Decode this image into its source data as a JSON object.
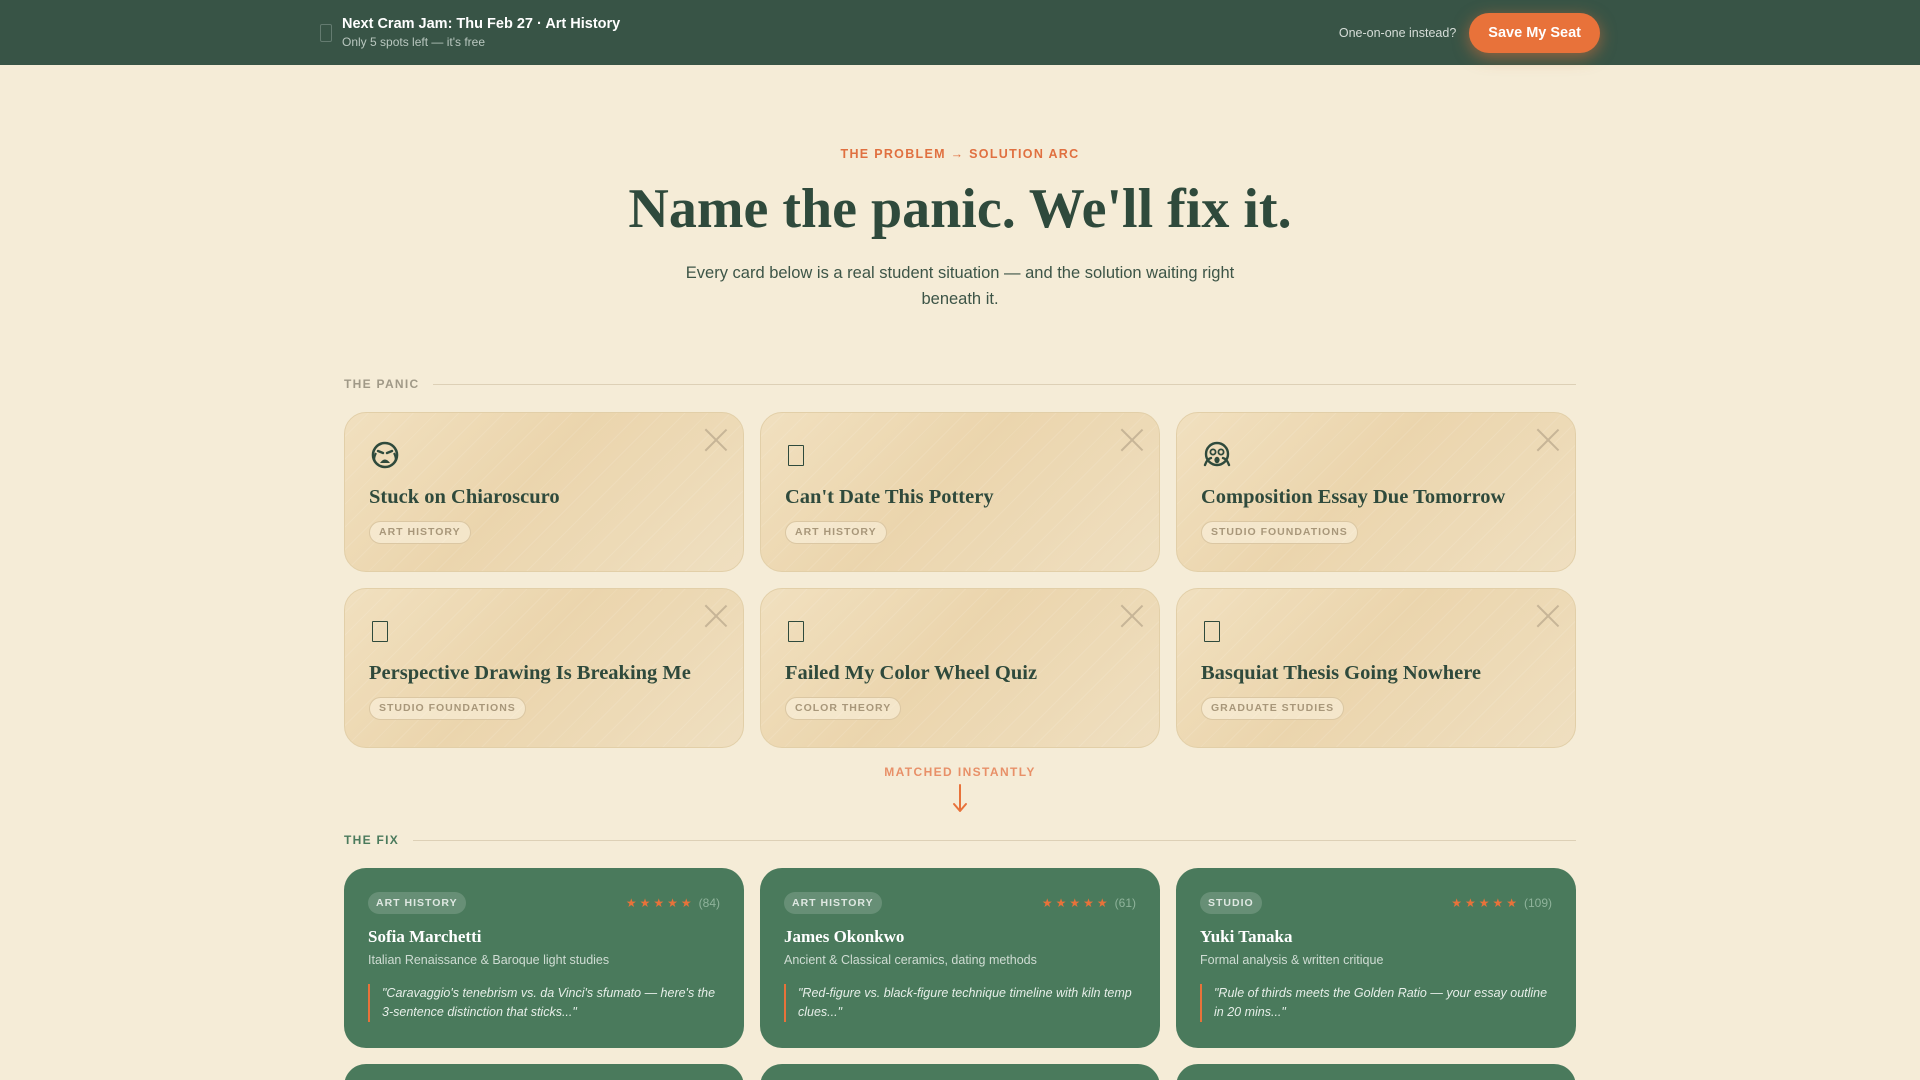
{
  "banner": {
    "title": "Next Cram Jam: Thu Feb 27 · Art History",
    "subtitle": "Only 5 spots left — it's free",
    "alt_link": "One-on-one instead?",
    "cta_label": "Save My Seat"
  },
  "hero": {
    "eyebrow": "THE PROBLEM → SOLUTION ARC",
    "title": "Name the panic. We'll fix it.",
    "subtitle": "Every card below is a real student situation — and the solution waiting right beneath it."
  },
  "panic": {
    "label": "THE PANIC",
    "cards": [
      {
        "icon": "crying-face-icon",
        "title": "Stuck on Chiaroscuro",
        "tag": "ART HISTORY"
      },
      {
        "icon": "pottery-icon",
        "title": "Can't Date This Pottery",
        "tag": "ART HISTORY"
      },
      {
        "icon": "screaming-face-icon",
        "title": "Composition Essay Due Tomorrow",
        "tag": "STUDIO FOUNDATIONS"
      },
      {
        "icon": "ruler-icon",
        "title": "Perspective Drawing Is Breaking Me",
        "tag": "STUDIO FOUNDATIONS"
      },
      {
        "icon": "palette-icon",
        "title": "Failed My Color Wheel Quiz",
        "tag": "COLOR THEORY"
      },
      {
        "icon": "book-icon",
        "title": "Basquiat Thesis Going Nowhere",
        "tag": "GRADUATE STUDIES"
      }
    ]
  },
  "matched": {
    "label": "MATCHED INSTANTLY"
  },
  "fix": {
    "label": "THE FIX",
    "cards": [
      {
        "tag": "ART HISTORY",
        "stars": "★★★★★",
        "count": "(84)",
        "name": "Sofia Marchetti",
        "specialty": "Italian Renaissance & Baroque light studies",
        "quote": "\"Caravaggio's tenebrism vs. da Vinci's sfumato — here's the 3-sentence distinction that sticks...\""
      },
      {
        "tag": "ART HISTORY",
        "stars": "★★★★★",
        "count": "(61)",
        "name": "James Okonkwo",
        "specialty": "Ancient & Classical ceramics, dating methods",
        "quote": "\"Red-figure vs. black-figure technique timeline with kiln temp clues...\""
      },
      {
        "tag": "STUDIO",
        "stars": "★★★★★",
        "count": "(109)",
        "name": "Yuki Tanaka",
        "specialty": "Formal analysis & written critique",
        "quote": "\"Rule of thirds meets the Golden Ratio — your essay outline in 20 mins...\""
      }
    ]
  },
  "colors": {
    "banner_bg": "#385446",
    "accent": "#e8723a",
    "page_bg": "#f5ecd7",
    "heading": "#2f4a3c",
    "fix_card": "#4a7a5c"
  }
}
